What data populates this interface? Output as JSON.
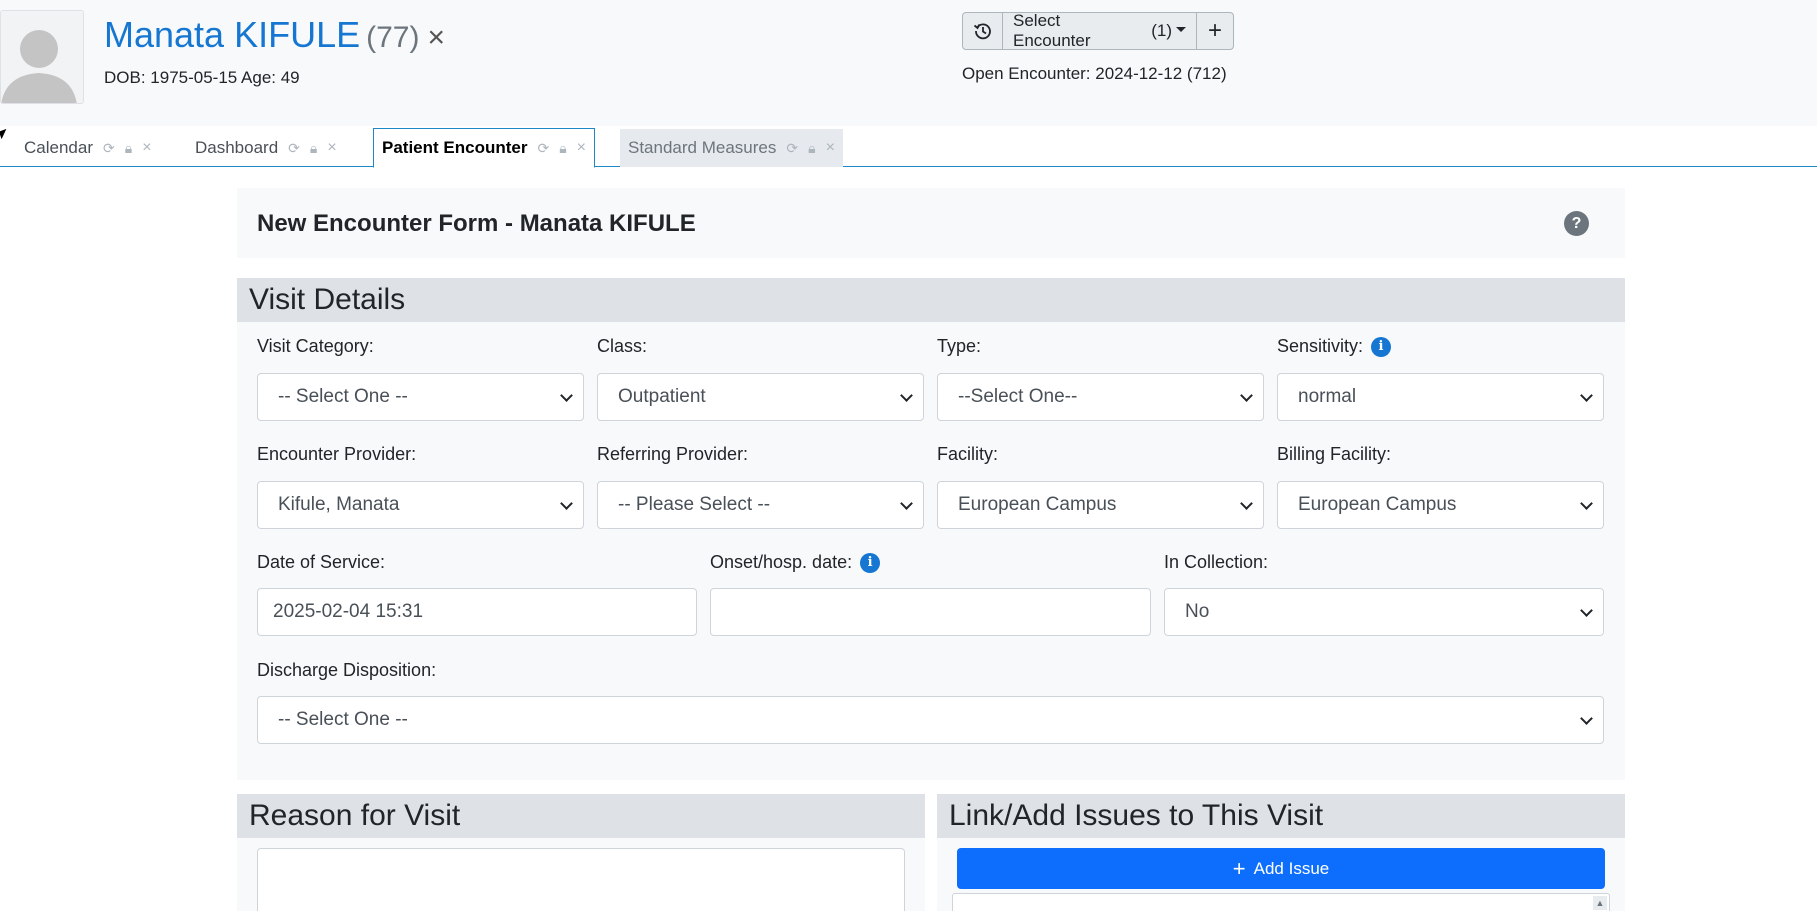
{
  "patient": {
    "name": "Manata KIFULE",
    "pid": "(77)",
    "close": "×",
    "dob_line": "DOB: 1975-05-15 Age: 49"
  },
  "encounter": {
    "select_label": "Select Encounter",
    "count": "(1)",
    "add": "+",
    "open": "Open Encounter: 2024-12-12 (712)"
  },
  "tabs": [
    {
      "label": "Calendar"
    },
    {
      "label": "Dashboard"
    },
    {
      "label": "Patient Encounter",
      "active": true
    },
    {
      "label": "Standard Measures"
    }
  ],
  "tab_icons": {
    "refresh": "⟳",
    "lock": "🔒",
    "close": "×"
  },
  "form": {
    "title": "New Encounter Form - Manata KIFULE",
    "help": "?"
  },
  "visit_details": {
    "heading": "Visit Details",
    "visit_category": {
      "label": "Visit Category:",
      "value": "-- Select One --"
    },
    "class": {
      "label": "Class:",
      "value": "Outpatient"
    },
    "type": {
      "label": "Type:",
      "value": "--Select One--"
    },
    "sensitivity": {
      "label": "Sensitivity:",
      "value": "normal"
    },
    "encounter_provider": {
      "label": "Encounter Provider:",
      "value": "Kifule, Manata"
    },
    "referring_provider": {
      "label": "Referring Provider:",
      "value": "-- Please Select --"
    },
    "facility": {
      "label": "Facility:",
      "value": "European Campus"
    },
    "billing_facility": {
      "label": "Billing Facility:",
      "value": "European Campus"
    },
    "date_of_service": {
      "label": "Date of Service:",
      "value": "2025-02-04 15:31"
    },
    "onset_date": {
      "label": "Onset/hosp. date:",
      "value": ""
    },
    "in_collection": {
      "label": "In Collection:",
      "value": "No"
    },
    "discharge": {
      "label": "Discharge Disposition:",
      "value": "-- Select One --"
    }
  },
  "reason": {
    "heading": "Reason for Visit"
  },
  "issues": {
    "heading": "Link/Add Issues to This Visit",
    "add_button": "Add Issue"
  },
  "colors": {
    "accent": "#1677d2",
    "button": "#0d6efd",
    "tab_border": "#1e88c7"
  }
}
